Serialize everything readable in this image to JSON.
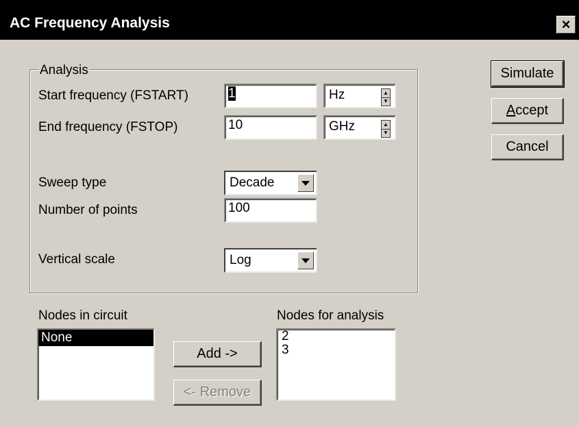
{
  "window": {
    "title": "AC Frequency Analysis",
    "close_label": "×"
  },
  "analysis": {
    "group_label": "Analysis",
    "start_label": "Start frequency (FSTART)",
    "start_value": "1",
    "start_unit": "Hz",
    "end_label": "End frequency (FSTOP)",
    "end_value": "10",
    "end_unit": "GHz",
    "sweep_label": "Sweep type",
    "sweep_value": "Decade",
    "points_label": "Number of points",
    "points_value": "100",
    "vscale_label": "Vertical scale",
    "vscale_value": "Log"
  },
  "buttons": {
    "simulate": "Simulate",
    "accept_first": "A",
    "accept_rest": "ccept",
    "cancel": "Cancel",
    "add": "Add ->",
    "remove": "<- Remove"
  },
  "nodes": {
    "circuit_label": "Nodes in circuit",
    "circuit_items": [
      "None"
    ],
    "analysis_label": "Nodes for analysis",
    "analysis_items": [
      "2",
      "3"
    ]
  }
}
